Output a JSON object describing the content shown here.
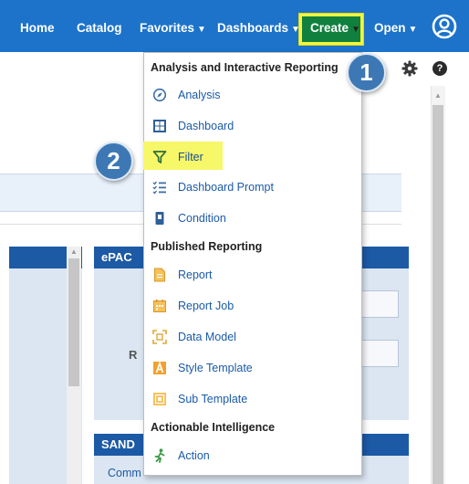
{
  "topnav": {
    "home": "Home",
    "catalog": "Catalog",
    "favorites": "Favorites",
    "dashboards": "Dashboards",
    "create": "Create",
    "open": "Open",
    "caret": "▼"
  },
  "menu": {
    "sections": {
      "analysis": "Analysis and Interactive Reporting",
      "published": "Published Reporting",
      "actionable": "Actionable Intelligence"
    },
    "items": [
      {
        "label": "Analysis",
        "icon": "analysis-icon"
      },
      {
        "label": "Dashboard",
        "icon": "dashboard-icon"
      },
      {
        "label": "Filter",
        "icon": "filter-icon"
      },
      {
        "label": "Dashboard Prompt",
        "icon": "prompt-icon"
      },
      {
        "label": "Condition",
        "icon": "condition-icon"
      },
      {
        "label": "Report",
        "icon": "report-icon"
      },
      {
        "label": "Report Job",
        "icon": "report-job-icon"
      },
      {
        "label": "Data Model",
        "icon": "data-model-icon"
      },
      {
        "label": "Style Template",
        "icon": "style-template-icon"
      },
      {
        "label": "Sub Template",
        "icon": "sub-template-icon"
      },
      {
        "label": "Action",
        "icon": "action-icon"
      }
    ]
  },
  "callouts": {
    "one": "1",
    "two": "2"
  },
  "background": {
    "card_title": "ePAC",
    "card_label": "R",
    "card2_title": "SAND",
    "card2_text": "Comm"
  },
  "help_glyph": "?",
  "colors": {
    "topbar": "#1c73c9",
    "create_bg": "#11803e",
    "highlight": "#f4f53c",
    "link": "#1a5aa8",
    "panel_header": "#1c5aa6",
    "badge": "#3d78b5"
  }
}
